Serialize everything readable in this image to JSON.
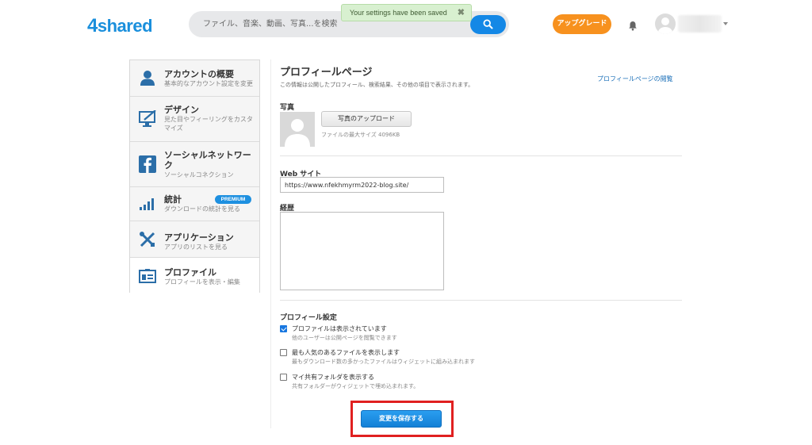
{
  "header": {
    "logo_digit": "4",
    "logo_text": "shared",
    "search_placeholder": "ファイル、音楽、動画、写真...を検索",
    "toast": "Your settings have been saved",
    "toast_close": "✖",
    "upgrade_label": "アップグレード",
    "brand_color": "#1a8fdc",
    "accent_orange": "#f7911e",
    "icons": [
      "search-icon",
      "bell-icon",
      "avatar",
      "chevron-down-icon"
    ]
  },
  "sidebar": {
    "items": [
      {
        "title": "アカウントの概要",
        "sub": "基本的なアカウント設定を変更",
        "icon": "user-icon"
      },
      {
        "title": "デザイン",
        "sub": "見た目やフィーリングをカスタマイズ",
        "icon": "monitor-brush-icon"
      },
      {
        "title": "ソーシャルネットワーク",
        "sub": "ソーシャルコネクション",
        "icon": "facebook-icon"
      },
      {
        "title": "統計",
        "sub": "ダウンロードの統計を見る",
        "badge": "PREMIUM",
        "icon": "bar-chart-icon"
      },
      {
        "title": "アプリケーション",
        "sub": "アプリのリストを見る",
        "icon": "tools-icon"
      },
      {
        "title": "プロファイル",
        "sub": "プロフィールを表示・編集",
        "icon": "profile-card-icon",
        "active": true
      }
    ]
  },
  "main": {
    "title": "プロフィールページ",
    "description": "この情報は公開したプロフィール、検索結果、その他の項目で表示されます。",
    "view_link": "プロフィールページの閲覧",
    "photo_label": "写真",
    "upload_label": "写真のアップロード",
    "max_size": "ファイルの最大サイズ 4096KB",
    "website_label": "Web サイト",
    "website_value": "https://www.nfekhmyrm2022-blog.site/",
    "bio_label": "経歴",
    "bio_value": "",
    "settings_label": "プロフィール設定",
    "options": [
      {
        "label": "プロファイルは表示されています",
        "sub": "他のユーザーは公開ページを閲覧できます",
        "checked": true
      },
      {
        "label": "最も人気のあるファイルを表示します",
        "sub": "最もダウンロード数の多かったファイルはウィジェットに組み込まれます",
        "checked": false
      },
      {
        "label": "マイ共有フォルダを表示する",
        "sub": "共有フォルダーがウィジェットで埋め込まれます。",
        "checked": false
      }
    ],
    "save_label": "変更を保存する"
  }
}
